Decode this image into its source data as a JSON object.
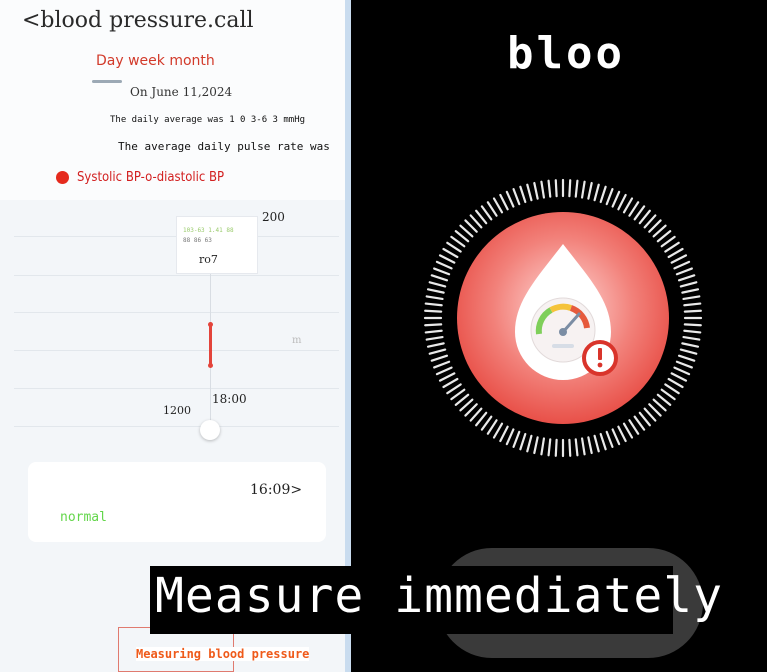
{
  "header": {
    "title": "<blood pressure.call",
    "tabs": "Day week month",
    "date": "On June 11,2024"
  },
  "summary": {
    "daily_average": "The daily average was 1 0 3-6 3 mmHg",
    "pulse": "The average daily pulse rate was"
  },
  "legend": {
    "label": "Systolic BP-o-diastolic BP",
    "color": "#e52a1d"
  },
  "chart": {
    "y_top": "200",
    "y_mid": "m",
    "tooltip_label": "ro7",
    "tooltip_line1": "103-63  1.41 88",
    "tooltip_line2": "88  86  63",
    "x_time": "18:00",
    "x_left": "1200"
  },
  "record": {
    "time": "16:09>",
    "status": "normal",
    "status_color": "#63d64a"
  },
  "measure": {
    "button_label": "Measuring blood pressure"
  },
  "right_panel": {
    "title": "bloo",
    "icon": "blood-pressure-gauge-icon",
    "accent": "#e8453a"
  },
  "overlay": {
    "caption": "Measure immediately"
  }
}
